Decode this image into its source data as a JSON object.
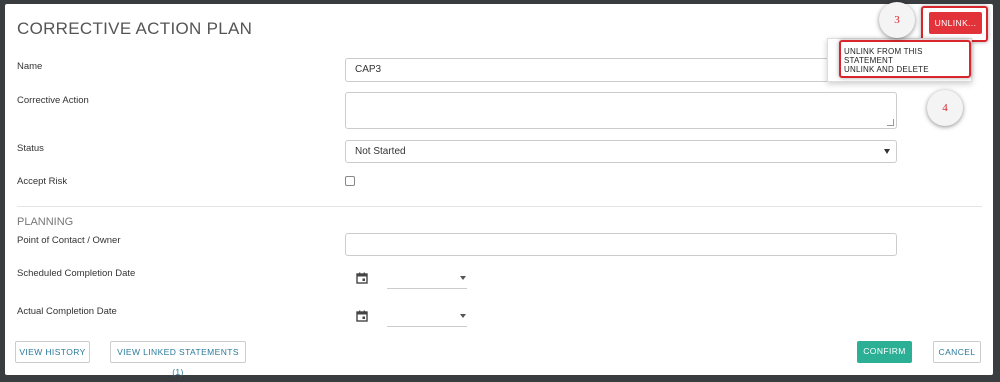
{
  "modal": {
    "title": "CORRECTIVE ACTION PLAN",
    "unlink_button": "UNLINK...",
    "callouts": [
      "3",
      "4"
    ],
    "menu_items": [
      "UNLINK FROM THIS STATEMENT",
      "UNLINK AND DELETE"
    ]
  },
  "form": {
    "name_label": "Name",
    "name_value": "CAP3",
    "corrective_action_label": "Corrective Action",
    "corrective_action_value": "",
    "status_label": "Status",
    "status_value": "Not Started",
    "accept_risk_label": "Accept Risk",
    "accept_risk_checked": false
  },
  "planning": {
    "section_title": "PLANNING",
    "poc_label": "Point of Contact / Owner",
    "poc_value": "",
    "scheduled_label": "Scheduled Completion Date",
    "actual_label": "Actual Completion Date"
  },
  "footer": {
    "view_history": "VIEW HISTORY",
    "view_linked": "VIEW LINKED STATEMENTS (1)",
    "confirm": "CONFIRM",
    "cancel": "CANCEL"
  },
  "colors": {
    "accent_teal": "#2bb096",
    "danger_red": "#e2323a",
    "highlight_red": "#d9262c"
  },
  "icons": [
    "calendar-icon",
    "chevron-down-icon"
  ]
}
